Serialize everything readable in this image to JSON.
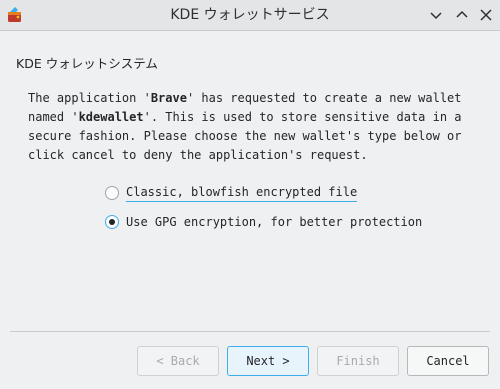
{
  "window": {
    "title": "KDE ウォレットサービス",
    "app_icon": "kwallet-icon",
    "controls": [
      "chevron-down-icon",
      "chevron-up-icon",
      "close-icon"
    ]
  },
  "page": {
    "section_title": "KDE ウォレットシステム",
    "description": {
      "part1": "The application '",
      "app_name": "Brave",
      "part2": "' has requested to create a new wallet named '",
      "wallet_name": "kdewallet",
      "part3": "'. This is used to store sensitive data in a secure fashion. Please choose the new wallet's type below or click cancel to deny the application's request."
    },
    "options": [
      {
        "label": "Classic, blowfish encrypted file",
        "checked": false
      },
      {
        "label": "Use GPG encryption, for better protection",
        "checked": true
      }
    ]
  },
  "buttons": {
    "back": "< Back",
    "next": "Next >",
    "finish": "Finish",
    "cancel": "Cancel"
  },
  "colors": {
    "accent": "#3daee9",
    "window_bg": "#eff0f1"
  }
}
